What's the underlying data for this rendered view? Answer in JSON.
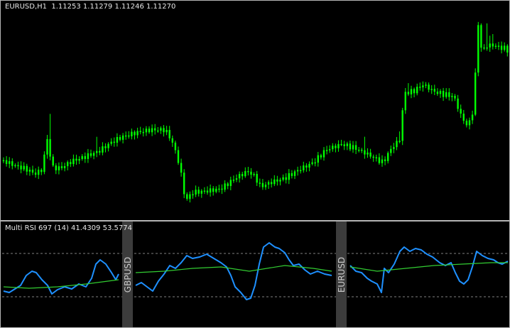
{
  "main_chart": {
    "symbol": "EURUSD,H1",
    "open": "1.11253",
    "high": "1.11279",
    "low": "1.11246",
    "close": "1.11270",
    "candle_color": "#00ff00",
    "background": "#000000"
  },
  "indicator": {
    "name": "Multi RSI 697",
    "period": "(14)",
    "value1": "41.4309",
    "value2": "53.5774",
    "segments": [
      {
        "label": ""
      },
      {
        "label": "GBPUSD"
      },
      {
        "label": "EURUSD"
      }
    ],
    "rsi_color": "#1e90ff",
    "signal_color": "#32cd32",
    "separator_color": "#3c3c3c",
    "level_line_color": "#808080"
  }
}
